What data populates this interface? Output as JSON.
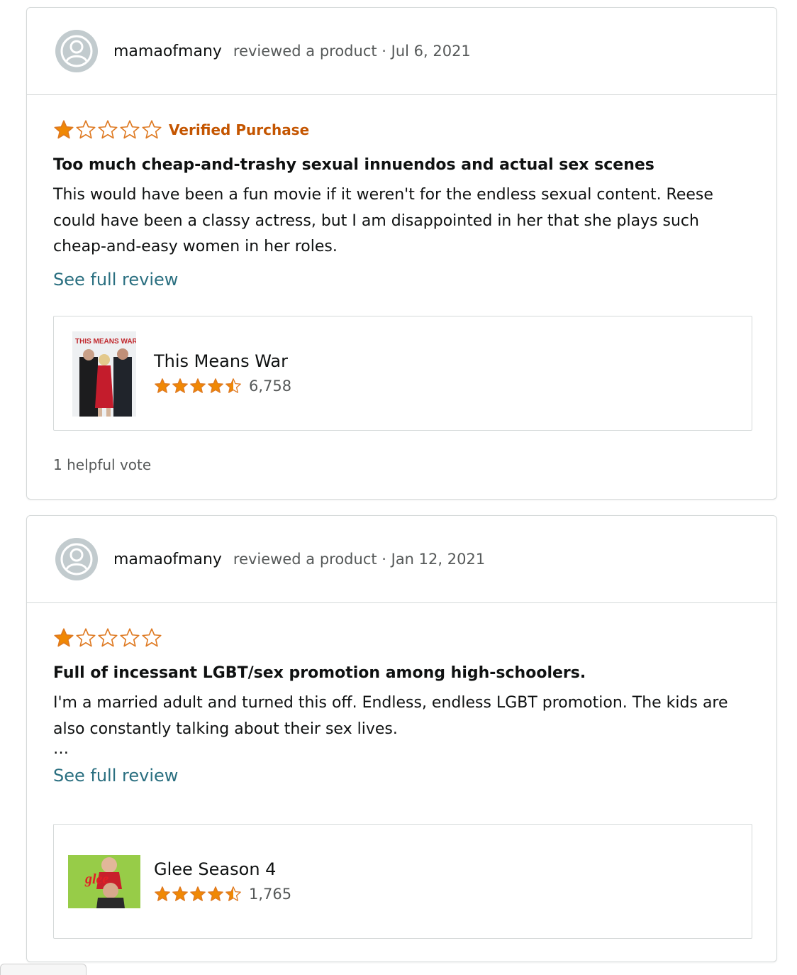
{
  "reviews": [
    {
      "reviewer": "mamaofmany",
      "meta": "reviewed a product · Jul 6, 2021",
      "rating": 1,
      "rating_max": 5,
      "verified": "Verified Purchase",
      "title": "Too much cheap-and-trashy sexual innuendos and actual sex scenes",
      "body": "This would have been a fun movie if it weren't for the endless sexual content. Reese could have been a classy actress, but I am disappointed in her that she plays such cheap-and-easy women in her roles.",
      "see_full": "See full review",
      "product": {
        "name": "This Means War",
        "rating": 4.5,
        "count": "6,758",
        "poster_text": "THIS MEANS WAR"
      },
      "helpful": "1 helpful vote"
    },
    {
      "reviewer": "mamaofmany",
      "meta": "reviewed a product · Jan 12, 2021",
      "rating": 1,
      "rating_max": 5,
      "title": "Full of incessant LGBT/sex promotion among high-schoolers.",
      "body": "I'm a married adult and turned this off. Endless, endless LGBT promotion. The kids are also constantly talking about their sex lives.",
      "ellipsis": "…",
      "see_full": "See full review",
      "product": {
        "name": "Glee Season 4",
        "rating": 4.5,
        "count": "1,765",
        "poster_text": "glee"
      }
    }
  ],
  "colors": {
    "star_fill": "#f08804",
    "star_outline": "#de7921",
    "verified": "#c45500",
    "link": "#2a6f80",
    "muted": "#565959"
  }
}
